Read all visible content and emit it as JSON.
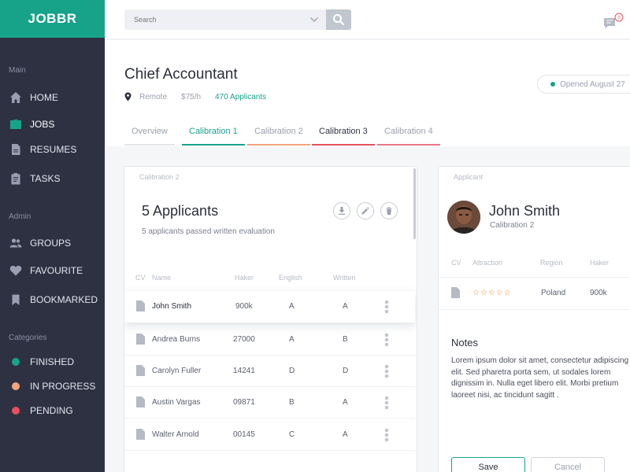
{
  "sidebar": {
    "brand": "JOBBR",
    "sections": {
      "main": "Main",
      "admin": "Admin",
      "categories": "Categories"
    },
    "main_items": [
      {
        "label": "HOME",
        "icon": "home-icon"
      },
      {
        "label": "JOBS",
        "icon": "briefcase-icon",
        "active": true
      },
      {
        "label": "RESUMES",
        "icon": "document-icon"
      },
      {
        "label": "TASKS",
        "icon": "clipboard-icon"
      }
    ],
    "admin_items": [
      {
        "label": "GROUPS",
        "icon": "group-icon"
      },
      {
        "label": "FAVOURITE",
        "icon": "heart-icon"
      },
      {
        "label": "BOOKMARKED",
        "icon": "bookmark-icon"
      }
    ],
    "category_items": [
      {
        "label": "FINISHED",
        "color": "#17a38a"
      },
      {
        "label": "IN PROGRESS",
        "color": "#f2a57b"
      },
      {
        "label": "PENDING",
        "color": "#e6505d"
      }
    ]
  },
  "topbar": {
    "search_placeholder": "Search",
    "notification_count": "0"
  },
  "job": {
    "title": "Chief Accountant",
    "location": "Remote",
    "rate": "$75/h",
    "applicants": "470 Applicants",
    "opened": "Opened August 27"
  },
  "tabs": [
    "Overview",
    "Calibration 1",
    "Calibration 2",
    "Calibration 3",
    "Calibration 4"
  ],
  "calibration": {
    "label": "Calibration 2",
    "count_title": "5 Applicants",
    "subtitle": "5 applicants passed written evaluation",
    "columns": {
      "cv": "CV",
      "name": "Name",
      "haker": "Haker",
      "english": "English",
      "written": "Written"
    },
    "rows": [
      {
        "name": "John Smith",
        "haker": "900k",
        "english": "A",
        "written": "A"
      },
      {
        "name": "Andrea Burns",
        "haker": "27000",
        "english": "A",
        "written": "B"
      },
      {
        "name": "Carolyn Fuller",
        "haker": "14241",
        "english": "D",
        "written": "D"
      },
      {
        "name": "Austin Vargas",
        "haker": "09871",
        "english": "B",
        "written": "A"
      },
      {
        "name": "Walter Arnold",
        "haker": "00145",
        "english": "C",
        "written": "A"
      }
    ]
  },
  "applicant": {
    "label": "Applicant",
    "name": "John Smith",
    "calibration": "Calibration 2",
    "columns": {
      "cv": "CV",
      "attraction": "Attraction",
      "region": "Region",
      "haker": "Haker"
    },
    "attraction_stars": "☆☆☆☆☆",
    "region": "Poland",
    "haker": "900k",
    "notes_title": "Notes",
    "notes": "Lorem ipsum dolor sit amet, consectetur adipiscing elit. Sed pharetra porta sem, ut sodales lorem dignissim in. Nulla eget libero elit. Morbi pretium laoreet nisi, ac tincidunt sagitt .",
    "save_label": "Save",
    "cancel_label": "Cancel"
  },
  "colors": {
    "accent": "#17a38a",
    "sidebar": "#2e3142"
  }
}
